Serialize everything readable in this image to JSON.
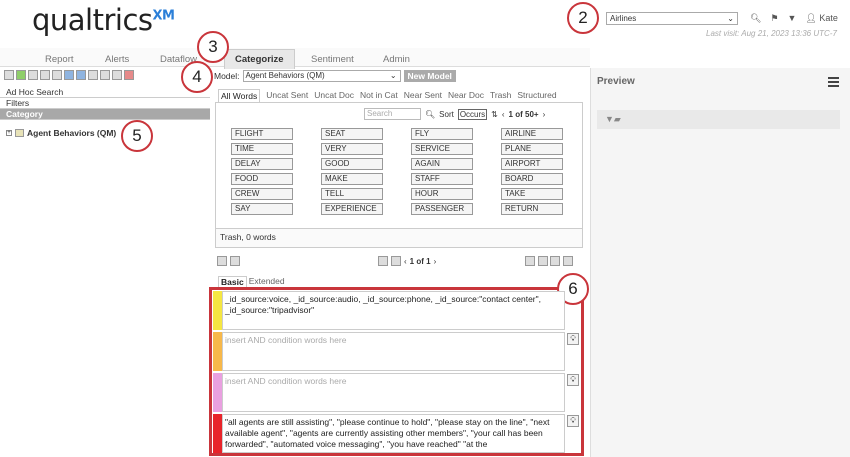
{
  "header": {
    "logo": "qualtrics",
    "logo_sup": "XM",
    "project": "Airlines",
    "user": "Kate",
    "last_visit": "Last visit: Aug 21, 2023 13:36 UTC-7"
  },
  "callouts": [
    "2",
    "3",
    "4",
    "5",
    "6"
  ],
  "tabs": [
    "Report",
    "Alerts",
    "Dataflow",
    "Categorize",
    "Sentiment",
    "Admin"
  ],
  "left": {
    "rows": [
      "Ad Hoc Search",
      "Filters",
      "Category"
    ],
    "tree_item": "Agent Behaviors (QM)"
  },
  "model": {
    "label": "Model:",
    "value": "Agent Behaviors (QM)",
    "new_button": "New Model"
  },
  "subtabs": [
    "All Words",
    "Uncat Sent",
    "Uncat Doc",
    "Not in Cat",
    "Near Sent",
    "Near Doc",
    "Trash",
    "Structured"
  ],
  "search": {
    "placeholder": "Search",
    "sort_label": "Sort",
    "sort_value": "Occurs",
    "pager": "1 of 50+"
  },
  "words": [
    "FLIGHT",
    "SEAT",
    "FLY",
    "AIRLINE",
    "TIME",
    "VERY",
    "SERVICE",
    "PLANE",
    "DELAY",
    "GOOD",
    "AGAIN",
    "AIRPORT",
    "FOOD",
    "MAKE",
    "STAFF",
    "BOARD",
    "CREW",
    "TELL",
    "HOUR",
    "TAKE",
    "SAY",
    "EXPERIENCE",
    "PASSENGER",
    "RETURN"
  ],
  "trash_text": "Trash, 0 words",
  "pager2": "1 of 1",
  "bottom_tabs": [
    "Basic",
    "Extended"
  ],
  "conditions": [
    {
      "color": "#f5e642",
      "text": "_id_source:voice, _id_source:audio, _id_source:phone, _id_source:\"contact center\", _id_source:\"tripadvisor\""
    },
    {
      "color": "#f7b84a",
      "text": "insert AND condition words here"
    },
    {
      "color": "#e9a0e0",
      "text": "insert AND condition words here"
    },
    {
      "color": "#e8242a",
      "text": "\"all agents are still assisting\", \"please continue to hold\", \"please stay on the line\", \"next available agent\", \"agents are currently assisting other members\", \"your call has been forwarded\", \"automated voice messaging\", \"you have reached\" \"at the"
    }
  ],
  "preview": {
    "title": "Preview"
  }
}
